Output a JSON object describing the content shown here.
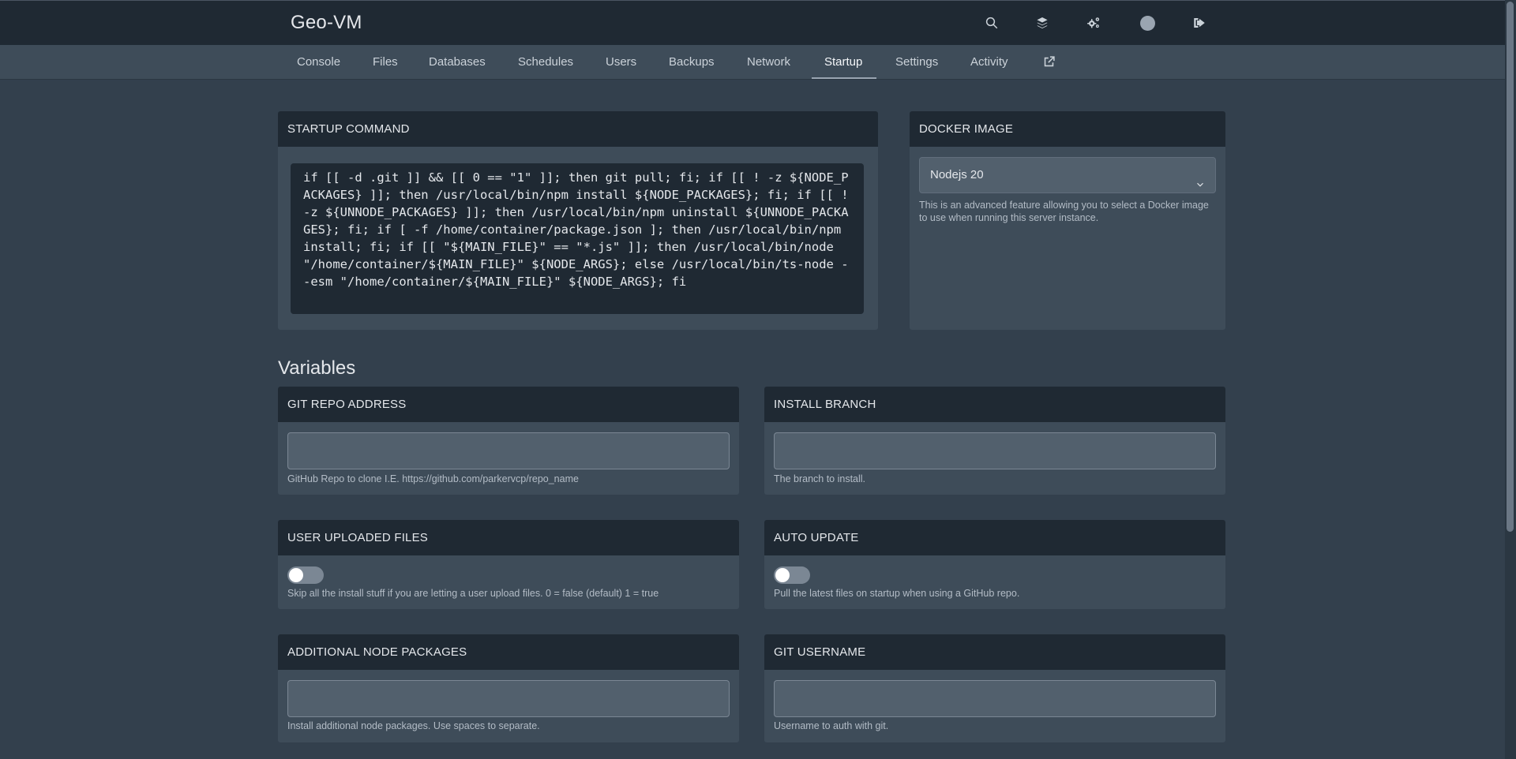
{
  "header": {
    "brand": "Geo-VM",
    "icons": [
      "search-icon",
      "layers-icon",
      "cogs-icon",
      "avatar",
      "logout-icon"
    ]
  },
  "nav": {
    "items": [
      "Console",
      "Files",
      "Databases",
      "Schedules",
      "Users",
      "Backups",
      "Network",
      "Startup",
      "Settings",
      "Activity"
    ],
    "active": "Startup",
    "external_icon": "external-link-icon"
  },
  "startup": {
    "title": "STARTUP COMMAND",
    "command": "if [[ -d .git ]] && [[ 0 == \"1\" ]]; then git pull; fi; if [[ ! -z ${NODE_PACKAGES} ]]; then /usr/local/bin/npm install ${NODE_PACKAGES}; fi; if [[ ! -z ${UNNODE_PACKAGES} ]]; then /usr/local/bin/npm uninstall ${UNNODE_PACKAGES}; fi; if [ -f /home/container/package.json ]; then /usr/local/bin/npm install; fi; if [[ \"${MAIN_FILE}\" == \"*.js\" ]]; then /usr/local/bin/node \"/home/container/${MAIN_FILE}\" ${NODE_ARGS}; else /usr/local/bin/ts-node --esm \"/home/container/${MAIN_FILE}\" ${NODE_ARGS}; fi"
  },
  "docker": {
    "title": "DOCKER IMAGE",
    "selected": "Nodejs 20",
    "help": "This is an advanced feature allowing you to select a Docker image to use when running this server instance."
  },
  "variables": {
    "title": "Variables",
    "git_repo": {
      "title": "GIT REPO ADDRESS",
      "value": "",
      "help": "GitHub Repo to clone I.E. https://github.com/parkervcp/repo_name"
    },
    "install_branch": {
      "title": "INSTALL BRANCH",
      "value": "",
      "help": "The branch to install."
    },
    "user_uploaded": {
      "title": "USER UPLOADED FILES",
      "enabled": false,
      "help": "Skip all the install stuff if you are letting a user upload files. 0 = false (default) 1 = true"
    },
    "auto_update": {
      "title": "AUTO UPDATE",
      "enabled": false,
      "help": "Pull the latest files on startup when using a GitHub repo."
    },
    "node_packages": {
      "title": "ADDITIONAL NODE PACKAGES",
      "value": "",
      "help": "Install additional node packages. Use spaces to separate."
    },
    "git_username": {
      "title": "GIT USERNAME",
      "value": "",
      "help": "Username to auth with git."
    }
  },
  "colors": {
    "background": "#33404d",
    "header": "#1f2933",
    "card": "#3e4c59",
    "input": "#52606d"
  }
}
